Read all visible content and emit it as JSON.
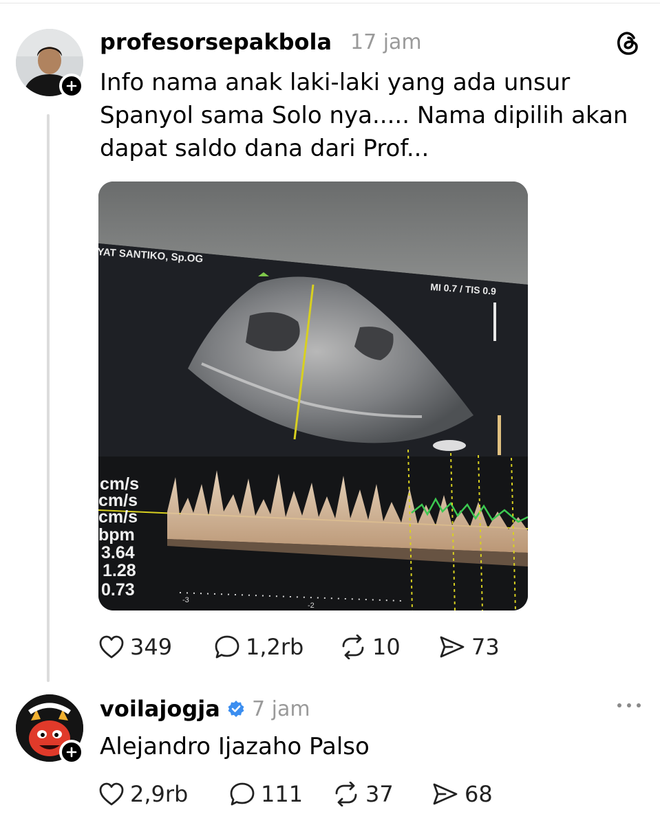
{
  "post": {
    "username": "profesorsepakbola",
    "time": "17 jam",
    "text": "Info nama anak laki-laki yang ada unsur Spanyol sama Solo nya..... Nama dipilih akan dapat saldo dana dari Prof...",
    "image": {
      "doctor_label": "YAT SANTIKO, Sp.OG",
      "mi_tis": "MI 0.7 / TIS 0.9",
      "readouts": [
        "cm/s",
        "cm/s",
        "cm/s",
        "bpm",
        "3.64",
        "1.28",
        "0.73"
      ],
      "scale_marks": [
        "-3",
        "-2"
      ]
    },
    "stats": {
      "likes": "349",
      "replies": "1,2rb",
      "reposts": "10",
      "shares": "73"
    }
  },
  "reply": {
    "username": "voilajogja",
    "time": "7 jam",
    "text": "Alejandro Ijazaho Palso",
    "stats": {
      "likes": "2,9rb",
      "replies": "111",
      "reposts": "37",
      "shares": "68"
    }
  },
  "colors": {
    "verified": "#3b8ef0",
    "muted": "#9a9a9a",
    "accent_red": "#e03a2a"
  },
  "icons": [
    "threads-logo-icon",
    "plus-icon",
    "heart-icon",
    "reply-icon",
    "repost-icon",
    "share-icon",
    "verified-icon",
    "more-icon"
  ]
}
